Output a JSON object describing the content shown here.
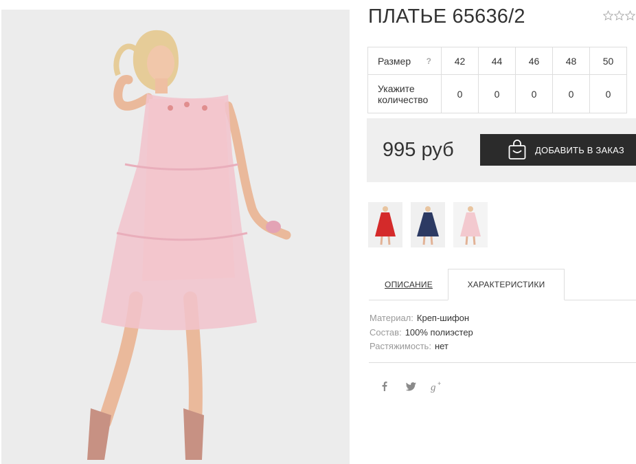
{
  "product": {
    "title": "ПЛАТЬЕ 65636/2",
    "rating_stars": 3
  },
  "sizes": {
    "size_label": "Размер",
    "help_mark": "?",
    "qty_label_line1": "Укажите",
    "qty_label_line2": "количество",
    "columns": [
      "42",
      "44",
      "46",
      "48",
      "50"
    ],
    "quantities": [
      "0",
      "0",
      "0",
      "0",
      "0"
    ]
  },
  "purchase": {
    "price": "995 руб",
    "add_button_label": "ДОБАВИТЬ В ЗАКАЗ"
  },
  "thumbnails": [
    {
      "color_name": "red",
      "dress_color": "#d42a2a"
    },
    {
      "color_name": "navy",
      "dress_color": "#2c3a63"
    },
    {
      "color_name": "pink",
      "dress_color": "#f3c9cf"
    }
  ],
  "tabs": [
    {
      "label": "ОПИСАНИЕ",
      "active": false
    },
    {
      "label": "ХАРАКТЕРИСТИКИ",
      "active": true
    }
  ],
  "specs": [
    {
      "key": "Материал:",
      "value": "Креп-шифон"
    },
    {
      "key": "Состав:",
      "value": "100% полиэстер"
    },
    {
      "key": "Растяжимость:",
      "value": "нет"
    }
  ],
  "social": [
    "facebook-icon",
    "twitter-icon",
    "google-plus-icon"
  ],
  "colors": {
    "button_bg": "#2b2b2b",
    "price_box_bg": "#efefef",
    "photo_bg": "#ececec",
    "dress_pink": "#f2c3cc"
  }
}
